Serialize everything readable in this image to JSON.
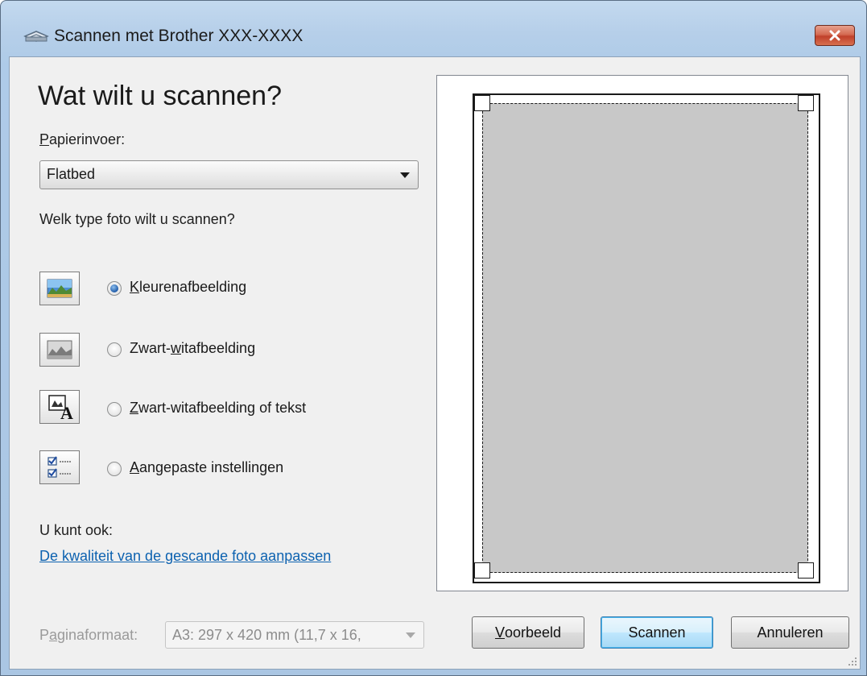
{
  "window": {
    "title": "Scannen met Brother XXX-XXXX",
    "close_label": "x"
  },
  "left": {
    "heading": "Wat wilt u scannen?",
    "paper_feed_label_first": "P",
    "paper_feed_label_rest": "apierinvoer:",
    "paper_feed_value": "Flatbed",
    "photo_type_question": "Welk type foto wilt u scannen?",
    "options": [
      {
        "icon": "color-picture-icon",
        "prefix": "",
        "accel": "K",
        "rest": "leurenafbeelding",
        "selected": true
      },
      {
        "icon": "grayscale-picture-icon",
        "prefix": "Zwart-",
        "accel": "w",
        "rest": "itafbeelding",
        "selected": false
      },
      {
        "icon": "black-white-text-icon",
        "prefix": "",
        "accel": "Z",
        "rest": "wart-witafbeelding of tekst",
        "selected": false
      },
      {
        "icon": "custom-settings-icon",
        "prefix": "",
        "accel": "A",
        "rest": "angepaste instellingen",
        "selected": false
      }
    ],
    "also_label": "U kunt ook:",
    "quality_link": "De kwaliteit van de gescande foto aanpassen",
    "page_size_label_pre": "P",
    "page_size_label_accel": "a",
    "page_size_label_rest": "ginaformaat:",
    "page_size_value": "A3: 297 x 420 mm (11,7 x 16,"
  },
  "buttons": {
    "preview_accel": "V",
    "preview_rest": "oorbeeld",
    "scan": "Scannen",
    "cancel": "Annuleren"
  },
  "colors": {
    "link": "#0d62b0",
    "scan_area": "#c8c8c8",
    "title_gradient": "#b6cfe9"
  }
}
